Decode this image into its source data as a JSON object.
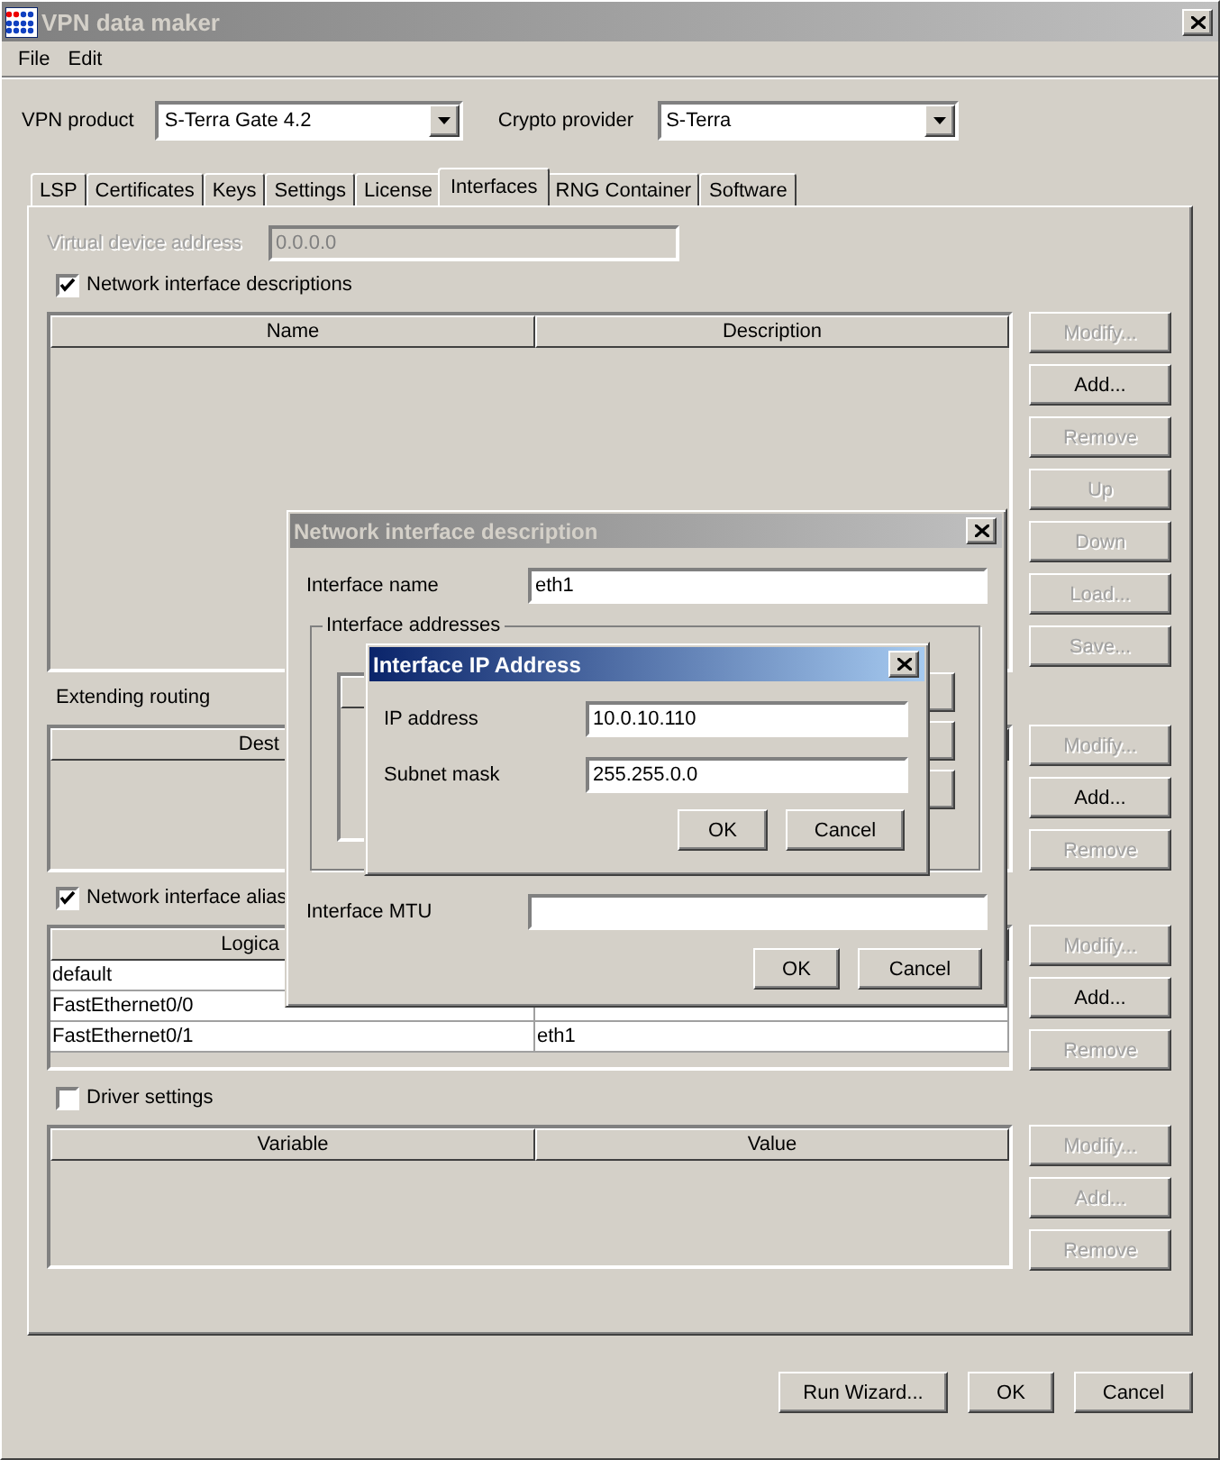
{
  "window": {
    "title": "VPN data maker",
    "active": false
  },
  "menu": [
    "File",
    "Edit"
  ],
  "product": {
    "label": "VPN product",
    "value": "S-Terra Gate 4.2"
  },
  "crypto": {
    "label": "Crypto provider",
    "value": "S-Terra"
  },
  "tabs": [
    {
      "label": "LSP",
      "selected": false
    },
    {
      "label": "Certificates",
      "selected": false
    },
    {
      "label": "Keys",
      "selected": false
    },
    {
      "label": "Settings",
      "selected": false
    },
    {
      "label": "License",
      "selected": false
    },
    {
      "label": "Interfaces",
      "selected": true
    },
    {
      "label": "RNG Container",
      "selected": false
    },
    {
      "label": "Software",
      "selected": false
    }
  ],
  "virtual_address": {
    "label": "Virtual device address",
    "value": "0.0.0.0",
    "disabled": true
  },
  "sections": [
    {
      "checkbox": {
        "label": "Network interface descriptions",
        "checked": true
      },
      "columns": [
        "Name",
        "Description"
      ],
      "buttons": [
        {
          "label": "Modify...",
          "disabled": true
        },
        {
          "label": "Add...",
          "disabled": false
        },
        {
          "label": "Remove",
          "disabled": true
        },
        {
          "label": "Up",
          "disabled": true
        },
        {
          "label": "Down",
          "disabled": true
        },
        {
          "label": "Load...",
          "disabled": true
        },
        {
          "label": "Save...",
          "disabled": true
        }
      ]
    },
    {
      "heading": "Extending routing",
      "columns": [
        "Dest"
      ],
      "buttons": [
        {
          "label": "Modify...",
          "disabled": true
        },
        {
          "label": "Add...",
          "disabled": false
        },
        {
          "label": "Remove",
          "disabled": true
        }
      ]
    },
    {
      "checkbox": {
        "label": "Network interface alias",
        "checked": true
      },
      "columns": [
        "Logica"
      ],
      "rows": [
        [
          "default"
        ],
        [
          "FastEthernet0/0"
        ],
        [
          "FastEthernet0/1",
          "eth1"
        ]
      ],
      "buttons": [
        {
          "label": "Modify...",
          "disabled": true
        },
        {
          "label": "Add...",
          "disabled": false
        },
        {
          "label": "Remove",
          "disabled": true
        }
      ]
    },
    {
      "checkbox": {
        "label": "Driver settings",
        "checked": false
      },
      "columns": [
        "Variable",
        "Value"
      ],
      "buttons": [
        {
          "label": "Modify...",
          "disabled": true
        },
        {
          "label": "Add...",
          "disabled": true
        },
        {
          "label": "Remove",
          "disabled": true
        }
      ]
    }
  ],
  "footer_buttons": [
    "Run Wizard...",
    "OK",
    "Cancel"
  ],
  "description_dialog": {
    "title": "Network interface description",
    "active": false,
    "name_label": "Interface name",
    "name_value": "eth1",
    "group_label": "Interface addresses",
    "mtu_label": "Interface MTU",
    "buttons": [
      "OK",
      "Cancel"
    ]
  },
  "ip_dialog": {
    "title": "Interface IP Address",
    "active": true,
    "fields": [
      {
        "label": "IP address",
        "value": "10.0.10.110"
      },
      {
        "label": "Subnet mask",
        "value": "255.255.0.0"
      }
    ],
    "buttons": [
      "OK",
      "Cancel"
    ]
  }
}
